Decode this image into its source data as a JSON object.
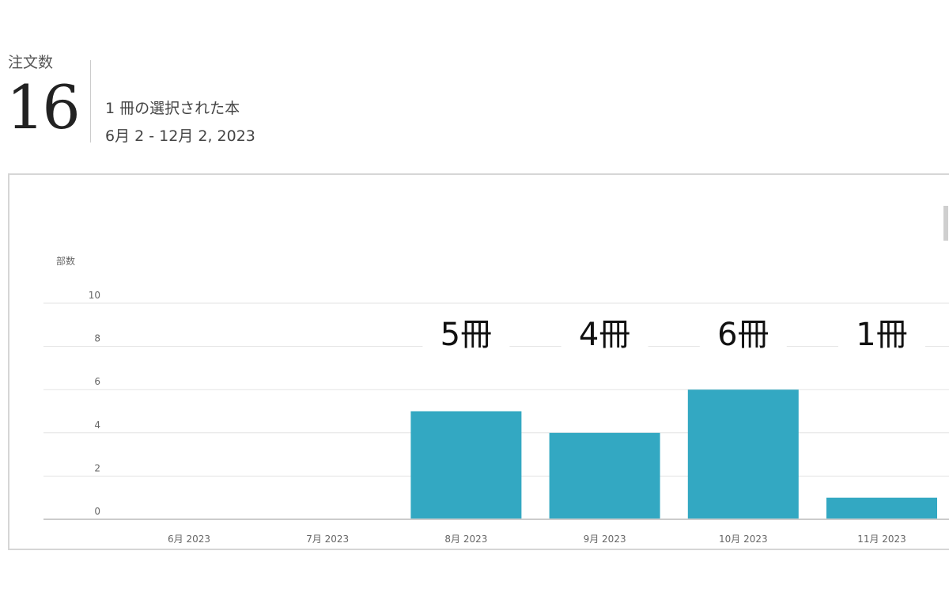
{
  "header": {
    "orders_label": "注文数",
    "orders_count": "16",
    "books_selected": "1 冊の選択された本",
    "date_range": "6月 2 - 12月 2, 2023"
  },
  "colors": {
    "bar": "#33a8c2",
    "gridline": "#e3e3e3",
    "axis": "#cccccc",
    "tick_text": "#666666",
    "annotation_text": "#111111"
  },
  "chart_data": {
    "type": "bar",
    "ylabel": "部数",
    "categories": [
      "6月 2023",
      "7月 2023",
      "8月 2023",
      "9月 2023",
      "10月 2023",
      "11月 2023"
    ],
    "values": [
      0,
      0,
      5,
      4,
      6,
      1
    ],
    "ylim": [
      0,
      10
    ],
    "yticks": [
      "0",
      "2",
      "4",
      "6",
      "8",
      "10"
    ],
    "grid": true,
    "annotations": [
      {
        "category": "8月 2023",
        "text": "5冊"
      },
      {
        "category": "9月 2023",
        "text": "4冊"
      },
      {
        "category": "10月 2023",
        "text": "6冊"
      },
      {
        "category": "11月 2023",
        "text": "1冊"
      }
    ]
  }
}
